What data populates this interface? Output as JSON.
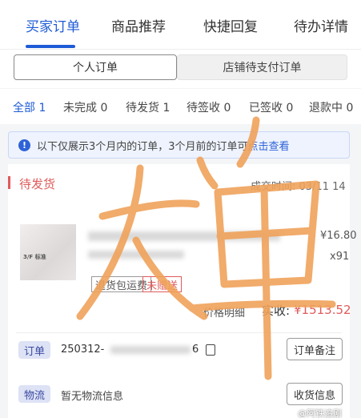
{
  "top_tabs": [
    {
      "label": "买家订单"
    },
    {
      "label": "商品推荐"
    },
    {
      "label": "快捷回复"
    },
    {
      "label": "待办详情"
    }
  ],
  "segment": {
    "left": "个人订单",
    "right": "店铺待支付订单"
  },
  "status_filters": [
    {
      "label": "全部 1"
    },
    {
      "label": "未完成 0"
    },
    {
      "label": "待发货 1"
    },
    {
      "label": "待签收 0"
    },
    {
      "label": "已签收 0"
    },
    {
      "label": "退款中 0"
    }
  ],
  "notice": {
    "text": "以下仅展示3个月内的订单，3个月前的订单可",
    "link": "点击查看"
  },
  "order": {
    "status": "待发货",
    "time": "成交时间: 03/11 14",
    "price": "¥16.80",
    "qty": "x91",
    "tag_return": "退货包运费",
    "tag_gift": "未赠送",
    "detail_link": "价格明细",
    "paid_label": "实收:",
    "paid_amount": "¥1513.52",
    "thumb_brand": "3/F 标准",
    "order_pill": "订单",
    "order_no_head": "250312-",
    "order_no_tail": "6",
    "remark_button": "订单备注",
    "logistics_pill": "物流",
    "logistics_text": "暂无物流信息",
    "receive_button": "收货信息"
  },
  "overlay_text": "大单",
  "watermark": "@阿铁追剧",
  "colors": {
    "accent": "#1e5bd6",
    "alert": "#e05a5a",
    "scribble": "#f0a25a"
  }
}
